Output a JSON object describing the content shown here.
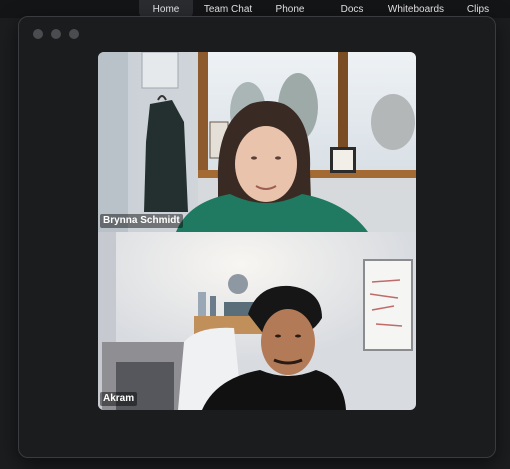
{
  "nav": {
    "items": [
      {
        "label": "Home",
        "active": true
      },
      {
        "label": "Team Chat"
      },
      {
        "label": "Phone"
      },
      {
        "label": "Docs"
      },
      {
        "label": "Whiteboards"
      },
      {
        "label": "Clips"
      }
    ]
  },
  "participants": [
    {
      "name": "Brynna Schmidt"
    },
    {
      "name": "Akram"
    }
  ]
}
